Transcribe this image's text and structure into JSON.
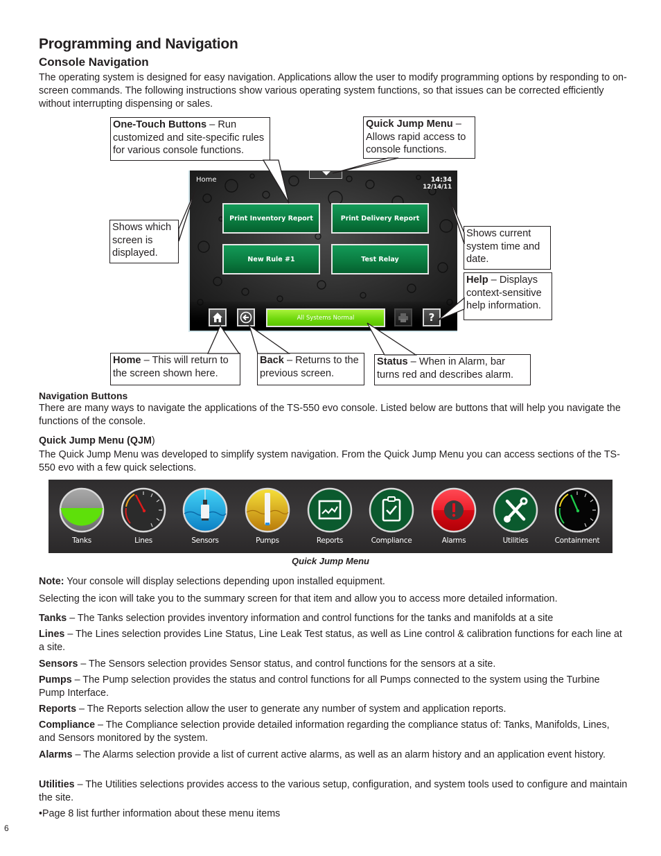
{
  "page": {
    "title": "Programming and Navigation",
    "section_title": "Console Navigation",
    "intro": "The operating system is designed for easy navigation. Applications allow the user to modify programming options by responding to on-screen commands. The following instructions show various operating system functions, so that issues can be corrected efficiently without interrupting dispensing or sales.",
    "page_number": "6"
  },
  "callouts": {
    "one_touch": {
      "bold": "One-Touch Buttons",
      "text": " – Run customized and site-specific rules for various console functions."
    },
    "quick_jump": {
      "bold": "Quick Jump Menu",
      "text": " – Allows rapid access to console functions."
    },
    "screen_shown": {
      "bold": "",
      "text": "Shows which screen is displayed."
    },
    "time_date": {
      "bold": "",
      "text": "Shows current system time and date."
    },
    "help": {
      "bold": "Help",
      "text": " – Displays context-sensitive help information."
    },
    "home": {
      "bold": "Home",
      "text": " – This will return to the screen shown here."
    },
    "back": {
      "bold": "Back",
      "text": " – Returns to the previous screen."
    },
    "status": {
      "bold": "Status",
      "text": " – When in Alarm, bar turns red and describes alarm."
    }
  },
  "console": {
    "screen_name": "Home",
    "time": "14:34",
    "date": "12/14/11",
    "one_touch_buttons": [
      "Print Inventory Report",
      "Print Delivery Report",
      "New Rule #1",
      "Test Relay"
    ],
    "status_text": "All Systems Normal",
    "status_color": "#71d90e",
    "nav_icons": [
      "home-icon",
      "back-arrow-icon",
      "printer-icon",
      "help-question-icon"
    ]
  },
  "navigation_buttons": {
    "heading": "Navigation Buttons",
    "text": "There are many ways to navigate the applications of the TS-550 evo console. Listed below are buttons that will help you navigate the functions of the console."
  },
  "qjm_section": {
    "heading_main": "Quick Jump Menu (",
    "heading_abbr": "QJM",
    "heading_end": ")",
    "text": "The Quick Jump Menu was developed to simplify system navigation. From the Quick Jump Menu you can access sections of the TS-550 evo with a few quick selections.",
    "caption": "Quick Jump Menu",
    "items": [
      {
        "label": "Tanks",
        "icon": "tank-level-icon",
        "color": "#5ee00a"
      },
      {
        "label": "Lines",
        "icon": "gauge-icon",
        "color": "#2b2b2b"
      },
      {
        "label": "Sensors",
        "icon": "sensor-probe-icon",
        "color": "#1ba8e0"
      },
      {
        "label": "Pumps",
        "icon": "pump-icon",
        "color": "#e8b815"
      },
      {
        "label": "Reports",
        "icon": "report-chart-icon",
        "color": "#0b5a2e"
      },
      {
        "label": "Compliance",
        "icon": "clipboard-check-icon",
        "color": "#0b5a2e"
      },
      {
        "label": "Alarms",
        "icon": "alarm-exclamation-icon",
        "color": "#e3101c"
      },
      {
        "label": "Utilities",
        "icon": "tools-icon",
        "color": "#0b5a2e"
      },
      {
        "label": "Containment",
        "icon": "containment-gauge-icon",
        "color": "#050505"
      }
    ]
  },
  "notes": {
    "note_bold": "Note:",
    "note_text": " Your console will display selections depending upon installed equipment.",
    "selecting": "Selecting the icon will take you to the summary screen for that item and allow you to access more detailed information."
  },
  "descriptions": [
    {
      "term": "Tanks",
      "text": " – The Tanks selection provides inventory information and control functions for the tanks and manifolds at a site"
    },
    {
      "term": "Lines",
      "text": " – The Lines selection provides Line Status, Line Leak Test status, as well as Line control & calibration functions for each line at a site."
    },
    {
      "term": "Sensors",
      "text": " – The Sensors selection provides Sensor status, and control functions for the sensors at a site."
    },
    {
      "term": "Pumps",
      "text": " – The Pump selection provides the status and control functions for all Pumps connected to the system using the Turbine Pump Interface."
    },
    {
      "term": "Reports",
      "text": " – The Reports selection allow the user to generate any number of system and application reports."
    },
    {
      "term": "Compliance",
      "text": " – The Compliance selection provide detailed information regarding the compliance status of: Tanks, Manifolds, Lines, and Sensors monitored by the system."
    },
    {
      "term": "Alarms",
      "text": " – The Alarms selection provide a list of current active alarms, as well as an alarm history and an application event history."
    },
    {
      "term": "Utilities",
      "text": " – The Utilities selections provides access to the various setup, configuration, and system tools used to configure and maintain the site."
    }
  ],
  "footnote": "•Page 8 list further information about these menu items"
}
